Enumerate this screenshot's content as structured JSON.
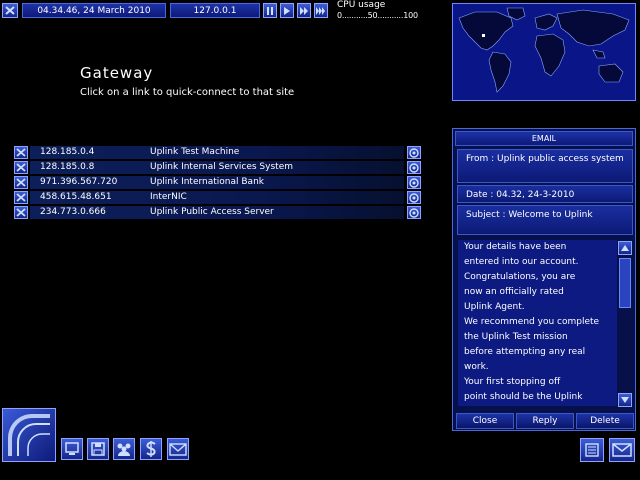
{
  "top": {
    "datetime": "04.34.46, 24 March 2010",
    "ip": "127.0.0.1",
    "cpu_label": "CPU usage",
    "cpu_scale": "0...........50...........100"
  },
  "page": {
    "title": "Gateway",
    "subtitle": "Click on a link to quick-connect to that site"
  },
  "links": [
    {
      "ip": "128.185.0.4",
      "name": "Uplink Test Machine"
    },
    {
      "ip": "128.185.0.8",
      "name": "Uplink Internal Services System"
    },
    {
      "ip": "971.396.567.720",
      "name": "Uplink International Bank"
    },
    {
      "ip": "458.615.48.651",
      "name": "InterNIC"
    },
    {
      "ip": "234.773.0.666",
      "name": "Uplink Public Access Server"
    }
  ],
  "email": {
    "header": "EMAIL",
    "from": "From : Uplink public access system",
    "date": "Date : 04.32, 24-3-2010",
    "subject": "Subject : Welcome to Uplink",
    "body_lines": [
      "Your details have been",
      "entered into our account.",
      "Congratulations, you are",
      "now an officially rated",
      "Uplink Agent.",
      "We recommend you complete",
      "the Uplink Test mission",
      "before attempting any real",
      "work.",
      "Your first stopping off",
      "point should be the Uplink"
    ],
    "buttons": {
      "close": "Close",
      "reply": "Reply",
      "delete": "Delete"
    }
  },
  "icons": {
    "dock": [
      "uplink-logo-icon",
      "computer-icon",
      "disk-icon",
      "people-icon",
      "finance-icon",
      "mail-icon"
    ],
    "bottom_right": [
      "memory-icon",
      "email-icon"
    ]
  },
  "colors": {
    "accent": "#1a2d9a",
    "border": "#5a78e6",
    "background": "#000000"
  }
}
